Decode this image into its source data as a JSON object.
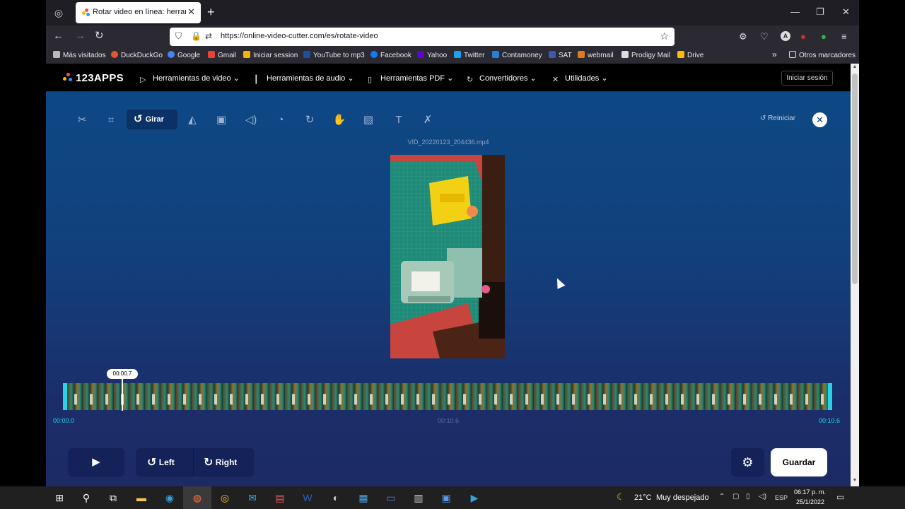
{
  "browser": {
    "tab_title": "Rotar video en línea: herramient",
    "tab_close": "✕",
    "new_tab": "+",
    "url": "https://online-video-cutter.com/es/rotate-video",
    "window_controls": [
      "—",
      "❐",
      "✕"
    ]
  },
  "bookmarks": [
    {
      "label": "Más visitados",
      "color": "#bbbbbb"
    },
    {
      "label": "DuckDuckGo",
      "color": "#de5833"
    },
    {
      "label": "Google",
      "color": "#4285f4"
    },
    {
      "label": "Gmail",
      "color": "#ea4335"
    },
    {
      "label": "Iniciar session",
      "color": "#f4b400"
    },
    {
      "label": "YouTube to mp3",
      "color": "#1f4e9c"
    },
    {
      "label": "Facebook",
      "color": "#1877f2"
    },
    {
      "label": "Yahoo",
      "color": "#6001d2"
    },
    {
      "label": "Twitter",
      "color": "#1da1f2"
    },
    {
      "label": "Contamoney",
      "color": "#2a7fd4"
    },
    {
      "label": "SAT",
      "color": "#3b5ba8"
    },
    {
      "label": "webmail",
      "color": "#e07a1f"
    },
    {
      "label": "Prodigy Mail",
      "color": "#dddddd"
    },
    {
      "label": "Drive",
      "color": "#fbbc04"
    }
  ],
  "bookmarks_more": "»",
  "bookmarks_other": "Otros marcadores",
  "site": {
    "logo": "123APPS",
    "menu": [
      {
        "label": "Herramientas de video ⌄",
        "icon": "video-icon"
      },
      {
        "label": "Herramientas de audio ⌄",
        "icon": "audio-icon"
      },
      {
        "label": "Herramientas PDF ⌄",
        "icon": "pdf-icon"
      },
      {
        "label": "Convertidores ⌄",
        "icon": "convert-icon"
      },
      {
        "label": "Utilidades ⌄",
        "icon": "utilities-icon"
      }
    ],
    "login": "Iniciar sesión",
    "active_tool": "Girar",
    "reset": "Reiniciar",
    "filename": "VID_20220123_204436.mp4",
    "playhead_time": "00:00.7",
    "time_start": "00:00.0",
    "time_mid": "00:10.6",
    "time_end": "00:10.6",
    "left_label": "Left",
    "right_label": "Right",
    "save_label": "Guardar"
  },
  "taskbar": {
    "weather_temp": "21°C",
    "weather_text": "Muy despejado",
    "language": "ESP",
    "time": "06:17 p. m.",
    "date": "25/1/2022"
  },
  "colors": {
    "accent": "#27d3e6",
    "site_bg": "#0c4a86",
    "control_bg": "#142259"
  }
}
